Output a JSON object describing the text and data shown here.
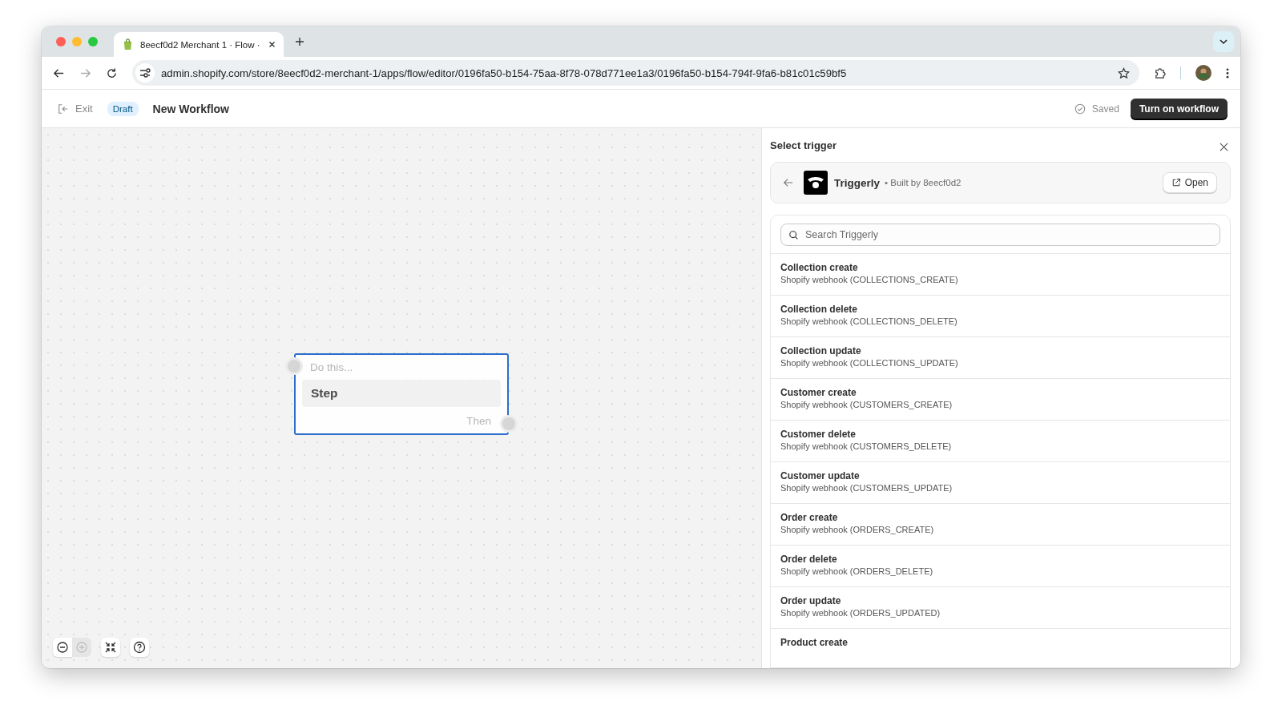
{
  "browser": {
    "tabs": [
      {
        "title": "8eecf0d2 Merchant 1 · Flow ·",
        "selected": true
      }
    ],
    "url": "admin.shopify.com/store/8eecf0d2-merchant-1/apps/flow/editor/0196fa50-b154-75aa-8f78-078d771ee1a3/0196fa50-b154-794f-9fa6-b81c01c59bf5"
  },
  "header": {
    "exit": "Exit",
    "status": "Draft",
    "title": "New Workflow",
    "saved": "Saved",
    "primary_button": "Turn on workflow"
  },
  "canvas": {
    "node": {
      "placeholder": "Do this...",
      "step": "Step",
      "then": "Then",
      "selected": true
    },
    "controls": [
      {
        "kind": "zoom-out",
        "disabled": false
      },
      {
        "kind": "zoom-in",
        "disabled": true
      },
      {
        "kind": "fit",
        "disabled": false
      },
      {
        "kind": "help",
        "disabled": false
      }
    ]
  },
  "panel": {
    "title": "Select trigger",
    "app": {
      "name": "Triggerly",
      "byline": "• Built by 8eecf0d2",
      "open": "Open"
    },
    "search": {
      "placeholder": "Search Triggerly"
    },
    "triggers": [
      {
        "title": "Collection create",
        "subtitle": "Shopify webhook (COLLECTIONS_CREATE)"
      },
      {
        "title": "Collection delete",
        "subtitle": "Shopify webhook (COLLECTIONS_DELETE)"
      },
      {
        "title": "Collection update",
        "subtitle": "Shopify webhook (COLLECTIONS_UPDATE)"
      },
      {
        "title": "Customer create",
        "subtitle": "Shopify webhook (CUSTOMERS_CREATE)"
      },
      {
        "title": "Customer delete",
        "subtitle": "Shopify webhook (CUSTOMERS_DELETE)"
      },
      {
        "title": "Customer update",
        "subtitle": "Shopify webhook (CUSTOMERS_UPDATE)"
      },
      {
        "title": "Order create",
        "subtitle": "Shopify webhook (ORDERS_CREATE)"
      },
      {
        "title": "Order delete",
        "subtitle": "Shopify webhook (ORDERS_DELETE)"
      },
      {
        "title": "Order update",
        "subtitle": "Shopify webhook (ORDERS_UPDATED)"
      },
      {
        "title": "Product create"
      }
    ]
  }
}
